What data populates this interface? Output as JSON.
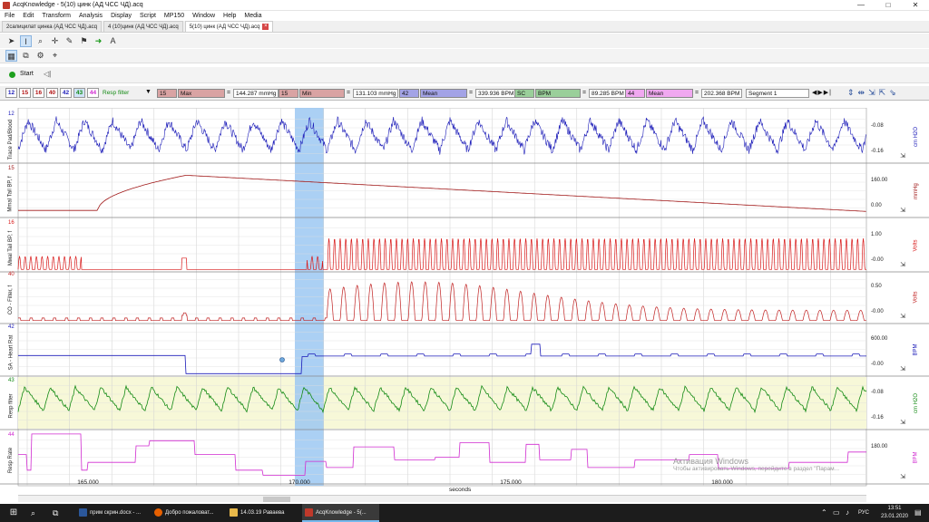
{
  "window": {
    "title": "AcqKnowledge - 5(10) цинк (АД ЧСС ЧД).acq",
    "minimize": "—",
    "maximize": "□",
    "close": "✕"
  },
  "menu": [
    "File",
    "Edit",
    "Transform",
    "Analysis",
    "Display",
    "Script",
    "MP150",
    "Window",
    "Help",
    "Media"
  ],
  "tabs": [
    {
      "label": "2салицилат цинка (АД ЧСС ЧД).acq",
      "active": false
    },
    {
      "label": "4 (10)цинк (АД ЧСС ЧД).acq",
      "active": false
    },
    {
      "label": "5(10) цинк (АД ЧСС ЧД).acq",
      "active": true
    }
  ],
  "toolbar": {
    "start_label": "Start"
  },
  "channel_buttons": [
    {
      "num": "12",
      "color": "#1a1ab8",
      "bg": "#ffffff"
    },
    {
      "num": "15",
      "color": "#b01010",
      "bg": "#ffffff"
    },
    {
      "num": "16",
      "color": "#b01010",
      "bg": "#ffffff"
    },
    {
      "num": "40",
      "color": "#b01010",
      "bg": "#ffffff"
    },
    {
      "num": "42",
      "color": "#1a1ab8",
      "bg": "#ffffff"
    },
    {
      "num": "43",
      "color": "#138a13",
      "bg": "#cfe3f7"
    },
    {
      "num": "44",
      "color": "#d02ad0",
      "bg": "#ffffff"
    }
  ],
  "resp_filter_label": "Resp filter",
  "measurements": [
    {
      "chan": "15",
      "func": "Max",
      "value": "144.287 mmHg",
      "color": "#d9a3a3"
    },
    {
      "chan": "15",
      "func": "Min",
      "value": "131.103 mmHg",
      "color": "#d9a3a3"
    },
    {
      "chan": "42",
      "func": "Mean",
      "value": "339.936 BPM",
      "color": "#a3a3e6"
    },
    {
      "chan": "SC",
      "func": "BPM",
      "value": "89.285 BPM",
      "color": "#9acf9a"
    },
    {
      "chan": "44",
      "func": "Mean",
      "value": "202.368 BPM",
      "color": "#f0a8f0"
    }
  ],
  "segment_label": "Segment 1",
  "channels": [
    {
      "num": "12",
      "label": "Trace Pad/Blood",
      "unit": "cm H2O",
      "scale": [
        "-0.08",
        "-0.16"
      ],
      "color": "#1a1ab8"
    },
    {
      "num": "15",
      "label": "Mmal Tail BP, f",
      "unit": "mmHg",
      "scale": [
        "160.00",
        "0.00"
      ],
      "color": "#a01818"
    },
    {
      "num": "16",
      "label": "Ммal Tail BP, f",
      "unit": "Volts",
      "scale": [
        "1.00",
        "-0.00"
      ],
      "color": "#d81818"
    },
    {
      "num": "40",
      "label": "CO - Filter, f",
      "unit": "Volts",
      "scale": [
        "0.50",
        "-0.00"
      ],
      "color": "#c02020"
    },
    {
      "num": "42",
      "label": "SA - Heart Rat",
      "unit": "BPM",
      "scale": [
        "600.00",
        "-0.00"
      ],
      "color": "#1a1ab8"
    },
    {
      "num": "43",
      "label": "Resp filter",
      "unit": "cm H2O",
      "scale": [
        "-0.08",
        "-0.16"
      ],
      "color": "#138a13"
    },
    {
      "num": "44",
      "label": "Resp Rate",
      "unit": "BPM",
      "scale": [
        "180.00",
        ""
      ],
      "color": "#d02ad0"
    }
  ],
  "x_axis": {
    "ticks": [
      "165.000",
      "170.000",
      "175.000",
      "180.000"
    ],
    "unit": "seconds"
  },
  "watermark": {
    "line1": "Активация Windows",
    "line2": "Чтобы активировать Windows, перейдите в раздел \"Парам..."
  },
  "taskbar": {
    "items": [
      {
        "label": "прим скрин.docx - ...",
        "icon": "#2b579a",
        "active": false
      },
      {
        "label": "Добро пожаловат...",
        "icon": "#e66000",
        "active": false
      },
      {
        "label": "14.03.19 Раваева",
        "icon": "#e8b84a",
        "active": false
      },
      {
        "label": "AcqKnowledge - 5(...",
        "icon": "#c0392b",
        "active": true
      }
    ],
    "lang": "РУС",
    "time": "13:51",
    "date": "23.01.2020"
  }
}
